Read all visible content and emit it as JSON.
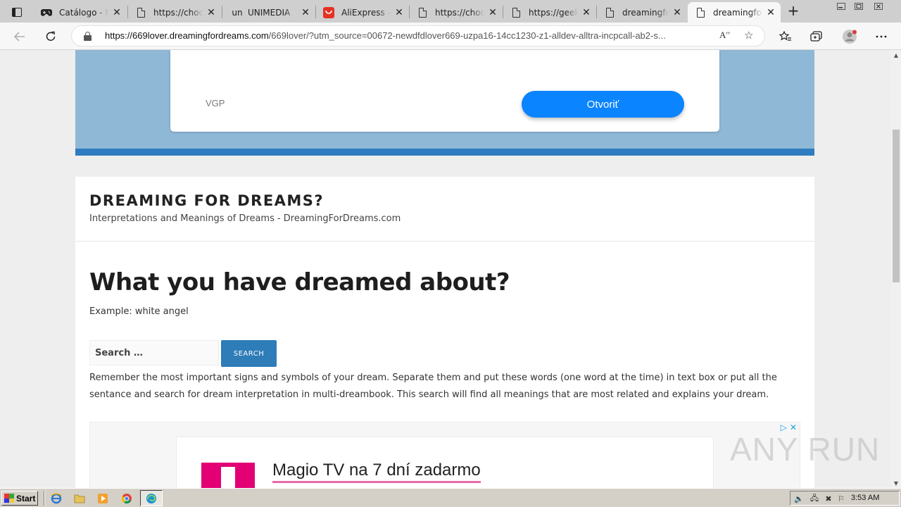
{
  "browser": {
    "tabs": [
      {
        "title": "Catálogo - M",
        "icon": "gamepad-icon"
      },
      {
        "title": "https://choo",
        "icon": "page-icon"
      },
      {
        "title": "UNIMEDIA",
        "icon": "unimedia-icon",
        "prefix": "un"
      },
      {
        "title": "AliExpress - C",
        "icon": "aliexpress-icon"
      },
      {
        "title": "https://choo",
        "icon": "page-icon"
      },
      {
        "title": "https://geek",
        "icon": "page-icon"
      },
      {
        "title": "dreamingfor",
        "icon": "page-icon"
      },
      {
        "title": "dreamingfor",
        "icon": "page-icon",
        "active": true
      }
    ],
    "url_host": "https://669lover.dreamingfordreams.com",
    "url_rest": "/669lover/?utm_source=00672-newdfdlover669-uzpa16-14cc1230-z1-alldev-alltra-incpcall-ab2-s...",
    "read_aloud": "Aʹʹ"
  },
  "ad_top": {
    "brand": "VGP",
    "button": "Otvoriť"
  },
  "site": {
    "title": "DREAMING FOR DREAMS?",
    "description": "Interpretations and Meanings of Dreams - DreamingForDreams.com",
    "heading": "What you have dreamed about?",
    "example": "Example: white angel",
    "search_placeholder": "Search …",
    "search_button": "SEARCH",
    "paragraph": "Remember the most important signs and symbols of your dream. Separate them and put these words (one word at the time) in text box or put all the sentance and search for dream interpretation in multi-dreambook. This search will find all meanings that are most related and explains your dream."
  },
  "ad_bottom": {
    "headline": "Magio TV na 7 dní zadarmo"
  },
  "watermark": "ANY RUN",
  "taskbar": {
    "start": "Start",
    "clock": "3:53 AM"
  },
  "colors": {
    "accent_blue": "#2e7cb8",
    "ad_button": "#0a84ff",
    "telekom_magenta": "#e20074"
  }
}
